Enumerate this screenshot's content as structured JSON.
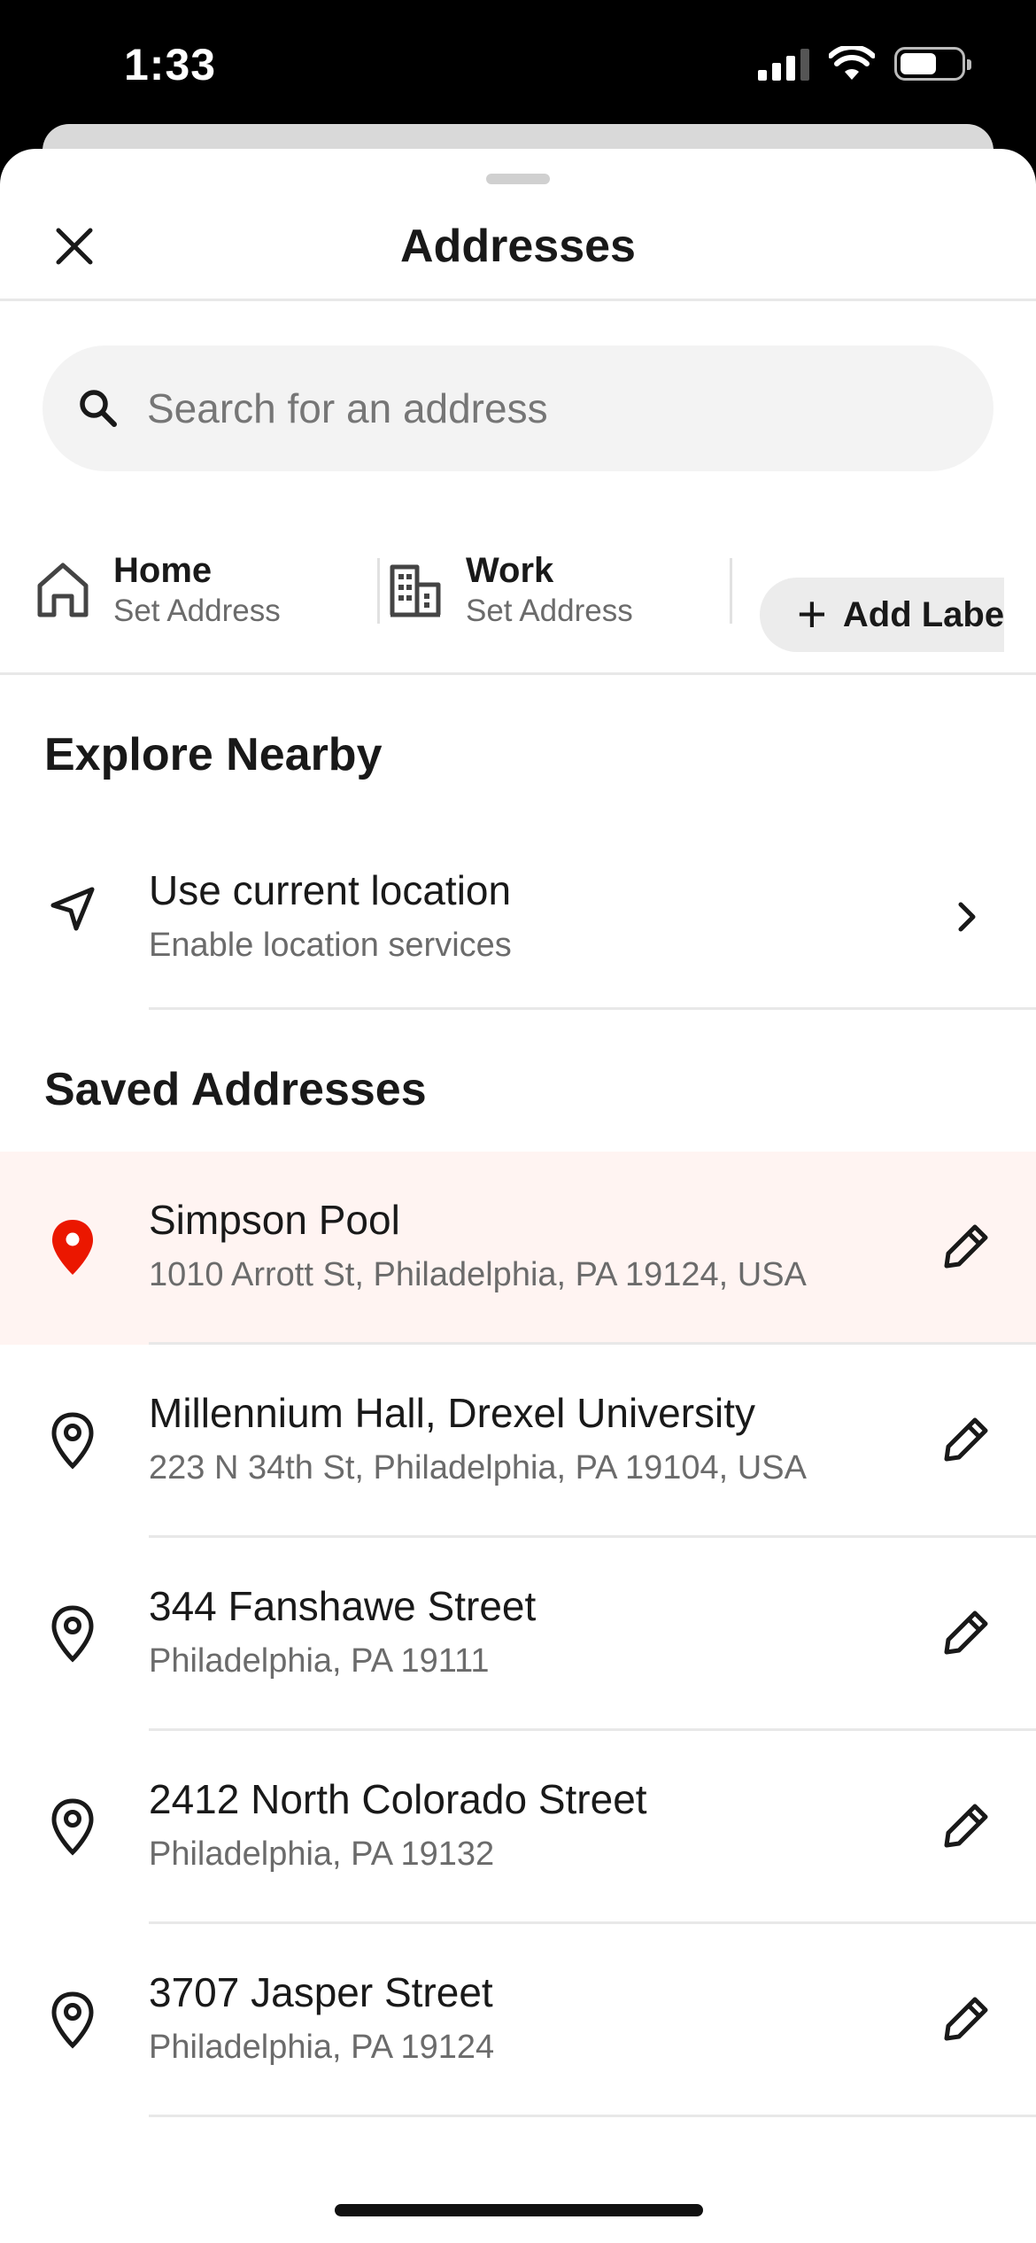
{
  "status_bar": {
    "time": "1:33"
  },
  "header": {
    "title": "Addresses"
  },
  "search": {
    "placeholder": "Search for an address"
  },
  "labels": [
    {
      "name": "Home",
      "sub": "Set Address",
      "icon": "home-icon"
    },
    {
      "name": "Work",
      "sub": "Set Address",
      "icon": "building-icon"
    }
  ],
  "add_label": {
    "text": "Add Label"
  },
  "explore": {
    "title": "Explore Nearby",
    "current_location": {
      "title": "Use current location",
      "sub": "Enable location services"
    }
  },
  "saved": {
    "title": "Saved Addresses",
    "items": [
      {
        "title": "Simpson Pool",
        "sub": "1010 Arrott St, Philadelphia, PA 19124, USA",
        "selected": true
      },
      {
        "title": "Millennium Hall, Drexel University",
        "sub": "223 N 34th St, Philadelphia, PA 19104, USA",
        "selected": false
      },
      {
        "title": "344 Fanshawe Street",
        "sub": "Philadelphia, PA 19111",
        "selected": false
      },
      {
        "title": "2412 North Colorado Street",
        "sub": "Philadelphia, PA 19132",
        "selected": false
      },
      {
        "title": "3707 Jasper Street",
        "sub": "Philadelphia, PA 19124",
        "selected": false
      }
    ]
  },
  "colors": {
    "accent_red": "#eb1700",
    "selected_bg": "#fff4f2"
  }
}
